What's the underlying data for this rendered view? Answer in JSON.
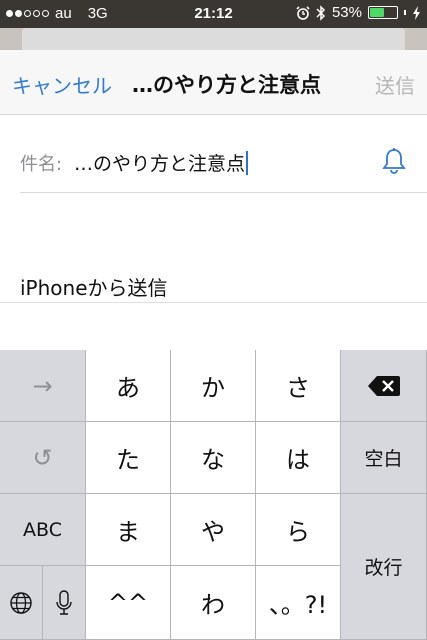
{
  "status_bar": {
    "carrier": "au",
    "network": "3G",
    "time": "21:12",
    "battery": "53%",
    "battery_level": 0.53
  },
  "nav": {
    "cancel": "キャンセル",
    "title": "…のやり方と注意点",
    "send": "送信"
  },
  "compose": {
    "subject_label": "件名:",
    "subject_value": "…のやり方と注意点",
    "signature": "iPhoneから送信"
  },
  "keyboard": {
    "arrow": "→",
    "undo": "↺",
    "row1": [
      "あ",
      "か",
      "さ"
    ],
    "row2": [
      "た",
      "な",
      "は"
    ],
    "row3": [
      "ま",
      "や",
      "ら"
    ],
    "row4": [
      "^^",
      "わ",
      "、。?!"
    ],
    "abc": "ABC",
    "space": "空白",
    "return": "改行"
  },
  "colors": {
    "accent": "#2f7bd8",
    "battery": "#4cd964",
    "disabled": "#b5b5b5"
  },
  "icons": [
    "wifi-signal-dots",
    "alarm-icon",
    "bluetooth-icon",
    "battery-icon",
    "charging-icon",
    "bell-icon",
    "backspace-icon",
    "globe-icon",
    "mic-icon"
  ]
}
